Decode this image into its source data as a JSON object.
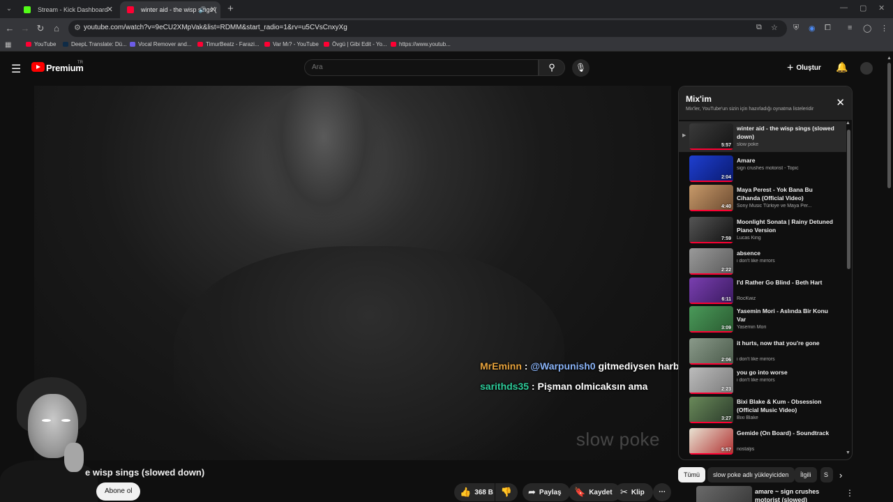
{
  "browser": {
    "tabs": [
      {
        "label": "Stream - Kick Dashboard",
        "favicon_color": "#53fc18"
      },
      {
        "label": "winter aid - the wisp sings (",
        "favicon_color": "#ff0033"
      }
    ],
    "url": "youtube.com/watch?v=9eCU2XMpVak&list=RDMM&start_radio=1&rv=u5CVsCnxyXg",
    "bookmarks": [
      {
        "label": "YouTube",
        "color": "#ff0033"
      },
      {
        "label": "DeepL Translate: Dü...",
        "color": "#0f2b46"
      },
      {
        "label": "Vocal Remover and...",
        "color": "#6c5ce7"
      },
      {
        "label": "TimurBeatz - Farazi...",
        "color": "#ff0033"
      },
      {
        "label": "Var Mı? - YouTube",
        "color": "#ff0033"
      },
      {
        "label": "Övgü | Gibi Edit - Yo...",
        "color": "#ff0033"
      },
      {
        "label": "https://www.youtub...",
        "color": "#ff0033"
      }
    ]
  },
  "masthead": {
    "brand": "Premium",
    "brand_sup": "TR",
    "search_placeholder": "Ara",
    "create_label": "Oluştur"
  },
  "video": {
    "watermark": "slow poke",
    "title": "e wisp sings (slowed down)",
    "subscribe_label": "Abone ol",
    "like_count": "368 B",
    "share_label": "Paylaş",
    "save_label": "Kaydet",
    "clip_label": "Klip"
  },
  "chat": [
    {
      "user": "MrEminn",
      "mention": "@Warpunish0",
      "text": "gitmediysen harbi atsana ban yaa"
    },
    {
      "user": "sarithds35",
      "text": "Pişman olmicaksın ama"
    }
  ],
  "mix": {
    "title": "Mix'im",
    "subtitle": "Mix'ler, YouTube'un sizin için hazırladığı oynatma listeleridir",
    "items": [
      {
        "title": "winter aid - the wisp sings (slowed down)",
        "channel": "slow poke",
        "duration": "5:57",
        "current": true,
        "colors": [
          "#3a3a3a",
          "#151515"
        ]
      },
      {
        "title": "Amare",
        "channel": "sign crushes motorist - Topic",
        "duration": "2:04",
        "colors": [
          "#1e3fd0",
          "#0a1a70"
        ]
      },
      {
        "title": "Maya Perest - Yok Bana Bu Cihanda (Official Video)",
        "channel": "Sony Music Türkiye ve Maya Per...",
        "duration": "4:40",
        "colors": [
          "#c89a6a",
          "#6b4a30"
        ]
      },
      {
        "title": "Moonlight Sonata | Rainy Detuned Piano Version",
        "channel": "Lucas King",
        "duration": "7:59",
        "colors": [
          "#555555",
          "#111111"
        ]
      },
      {
        "title": "absence",
        "channel": "i don't like mirrors",
        "duration": "2:22",
        "colors": [
          "#9a9a9a",
          "#5a5a5a"
        ]
      },
      {
        "title": "I'd Rather Go Blind - Beth Hart",
        "channel": "RocKwiz",
        "duration": "6:11",
        "colors": [
          "#7a3fb0",
          "#3a1a60"
        ]
      },
      {
        "title": "Yasemin Mori - Aslında Bir Konu Var",
        "channel": "Yasemin Mori",
        "duration": "3:09",
        "colors": [
          "#4a9a5a",
          "#2a5a30"
        ]
      },
      {
        "title": "it hurts, now that you're gone",
        "channel": "i don't like mirrors",
        "duration": "2:06",
        "colors": [
          "#8a9a8a",
          "#4a5a4a"
        ]
      },
      {
        "title": "you go into worse",
        "channel": "i don't like mirrors",
        "duration": "2:23",
        "colors": [
          "#bcbcbc",
          "#7a7a7a"
        ]
      },
      {
        "title": "Bixi Blake & Kum - Obsession (Official Music Video)",
        "channel": "Bixi Blake",
        "duration": "3:27",
        "colors": [
          "#6a8a5a",
          "#2a3a2a"
        ]
      },
      {
        "title": "Gemide (On Board) - Soundtrack",
        "channel": "nostaljis",
        "duration": "5:57",
        "colors": [
          "#e9e3d3",
          "#b03030"
        ]
      }
    ]
  },
  "chips": [
    "Tümü",
    "slow poke adlı yükleyiciden",
    "İlgili",
    "S"
  ],
  "recommendation": {
    "title": "amare ~ sign crushes motorist (slowed)"
  }
}
